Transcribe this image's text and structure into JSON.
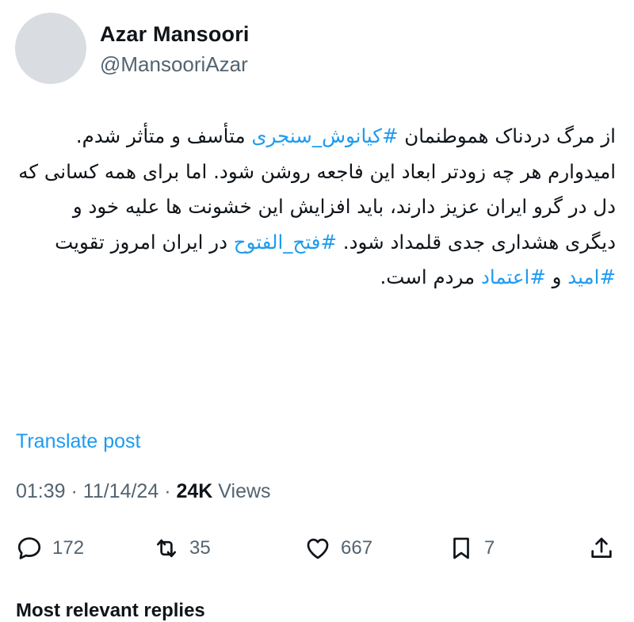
{
  "author": {
    "name": "Azar Mansoori",
    "handle": "@MansooriAzar"
  },
  "tweet": {
    "p1_before": "از مرگ دردناک هموطنمان ",
    "p1_tag": "#کیانوش_سنجری",
    "p1_after": " متأسف و متأثر شدم.",
    "p2_before": "امیدوارم هر چه زودتر ابعاد این فاجعه روشن شود. اما برای همه کسانی که دل در گرو ایران عزیز دارند، باید افزایش این خشونت ها علیه خود و دیگری هشداری جدی قلمداد شود. ",
    "tag_fath": "#فتح_الفتوح",
    "p2_mid1": " در ایران امروز تقویت ",
    "tag_omid": "#امید",
    "p2_mid2": " و ",
    "tag_etemad": "#اعتماد",
    "p2_after": " مردم است."
  },
  "translate_label": "Translate post",
  "meta": {
    "time": "01:39",
    "sep": " · ",
    "date": "11/14/24",
    "views_count": "24K",
    "views_label": " Views"
  },
  "actions": {
    "replies": "172",
    "reposts": "35",
    "likes": "667",
    "bookmarks": "7"
  },
  "cutoff_text": "Most relevant replies",
  "colors": {
    "link": "#1d9bf0",
    "secondary": "#536471",
    "text": "#0f1419"
  },
  "icons": [
    "reply-icon",
    "repost-icon",
    "like-icon",
    "bookmark-icon",
    "share-icon"
  ]
}
